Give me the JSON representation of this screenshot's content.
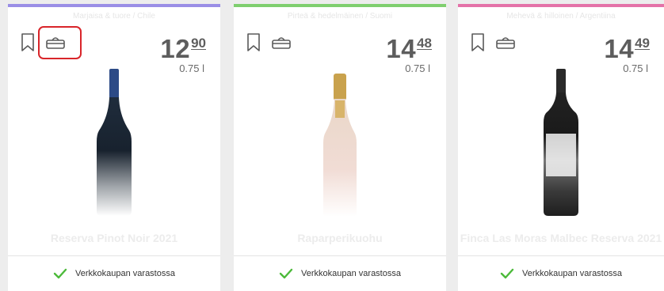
{
  "colors": {
    "accent_1": "#9a8ee6",
    "accent_2": "#7fcf6f",
    "accent_3": "#e472a8",
    "highlight": "#d9252a",
    "check": "#4cba3a"
  },
  "products": [
    {
      "category": "Marjaisa & tuore / Chile",
      "price_euros": "12",
      "price_cents": "90",
      "volume": "0.75 l",
      "name": "Reserva Pinot Noir 2021",
      "stock": "Verkkokaupan varastossa",
      "bookmark_icon": "bookmark-icon",
      "basket_icon": "shopping-basket-icon"
    },
    {
      "category": "Pirteä & hedelmäinen / Suomi",
      "price_euros": "14",
      "price_cents": "48",
      "volume": "0.75 l",
      "name": "Raparperikuohu",
      "stock": "Verkkokaupan varastossa",
      "bookmark_icon": "bookmark-icon",
      "basket_icon": "shopping-basket-icon"
    },
    {
      "category": "Mehevä & hilloinen / Argentiina",
      "price_euros": "14",
      "price_cents": "49",
      "volume": "0.75 l",
      "name": "Finca Las Moras Malbec Reserva 2021",
      "stock": "Verkkokaupan varastossa",
      "bookmark_icon": "bookmark-icon",
      "basket_icon": "shopping-basket-icon"
    }
  ]
}
